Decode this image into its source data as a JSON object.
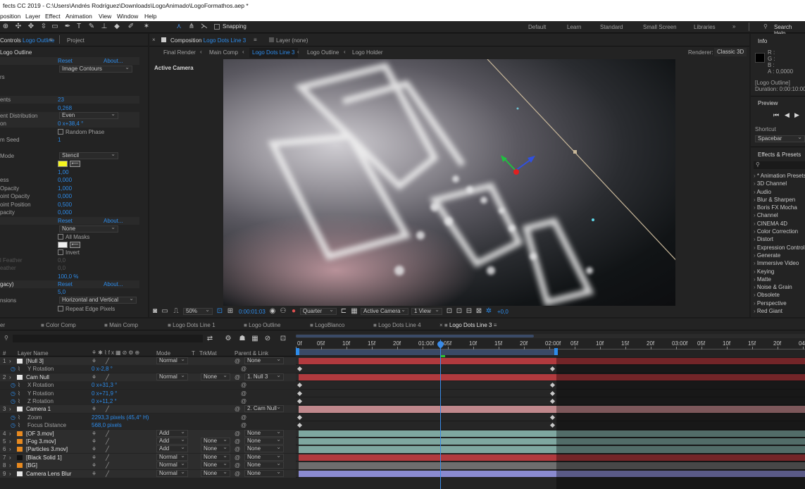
{
  "title": "fects CC 2019 - C:\\Users\\Andrés Rodríguez\\Downloads\\LogoAnimado\\LogoFormathos.aep *",
  "menu": [
    "position",
    "Layer",
    "Effect",
    "Animation",
    "View",
    "Window",
    "Help"
  ],
  "toolbar": {
    "snapping": "Snapping",
    "workspaces": [
      "Default",
      "Learn",
      "Standard",
      "Small Screen",
      "Libraries"
    ],
    "search": "Search Help"
  },
  "effects": {
    "tab1_prefix": "Controls",
    "tab1_name": "Logo Outline",
    "tab2": "Project",
    "layer": "Logo Outline",
    "reset": "Reset",
    "about": "About...",
    "image_contours": "Image Contours",
    "rs": "rs",
    "segments_label": "ents",
    "segments": "23",
    "length": "0,268",
    "seg_dist_label": "ent Distribution",
    "seg_dist": "Even",
    "rotation_label": "on",
    "rotation": "0 x+38,4 °",
    "random_phase": "Random Phase",
    "seed_label": "m Seed",
    "seed": "1",
    "mode_label": "Mode",
    "mode": "Stencil",
    "val100": "1,00",
    "thickness_label": "ess",
    "thickness": "0,000",
    "opacity_label": "Opacity",
    "opacity": "1,000",
    "mid_opacity_label": "oint Opacity",
    "mid_opacity": "0,000",
    "mid_pos_label": "oint Position",
    "mid_pos": "0,500",
    "opacity2_label": "pacity",
    "opacity2": "0,000",
    "reset2": "Reset",
    "about2": "About...",
    "none": "None",
    "all_masks": "All Masks",
    "invert": "Invert",
    "feather_label": "l Feather",
    "feather": "0,0",
    "feather2_label": "eather",
    "feather2": "0,0",
    "pct": "100,0 %",
    "legacy_label": "gacy)",
    "reset3": "Reset",
    "about3": "About...",
    "five": "5,0",
    "dims_label": "nsions",
    "dims": "Horizontal and Vertical",
    "repeat": "Repeat Edge Pixels"
  },
  "comp": {
    "comp_label": "Composition",
    "comp_name": "Logo Dots Line 3",
    "layer_none": "Layer  (none)",
    "breadcrumbs": [
      "Final Render",
      "Main Comp",
      "Logo Dots Line 3",
      "Logo Outline",
      "Logo Holder"
    ],
    "renderer_label": "Renderer:",
    "renderer": "Classic 3D",
    "active_camera": "Active Camera",
    "zoom": "50%",
    "timecode": "0:00:01:03",
    "resolution": "Quarter",
    "camera_view": "Active Camera",
    "views": "1 View",
    "exposure": "+0,0"
  },
  "info": {
    "title": "Info",
    "r": "R :",
    "g": "G :",
    "b": "B :",
    "a": "A : 0,0000",
    "layer": "[Logo Outline]",
    "duration": "Duration: 0:00:10:00"
  },
  "preview": {
    "title": "Preview",
    "shortcut": "Shortcut",
    "spacebar": "Spacebar"
  },
  "fx": {
    "title": "Effects & Presets",
    "items": [
      "* Animation Presets",
      "3D Channel",
      "Audio",
      "Blur & Sharpen",
      "Boris FX Mocha",
      "Channel",
      "CINEMA 4D",
      "Color Correction",
      "Distort",
      "Expression Controls",
      "Generate",
      "Immersive Video",
      "Keying",
      "Matte",
      "Noise & Grain",
      "Obsolete",
      "Perspective",
      "Red Giant"
    ]
  },
  "timeline": {
    "tabs": [
      "er",
      "Color Comp",
      "Main Comp",
      "Logo Dots Line 1",
      "Logo Outline",
      "LogoBlanco",
      "Logo Dots Line 4",
      "Logo Dots Line 3"
    ],
    "headers": {
      "hash": "#",
      "name": "Layer Name",
      "mode": "Mode",
      "t": "T",
      "trkmat": "TrkMat",
      "parent": "Parent & Link"
    },
    "ruler": [
      "0f",
      "05f",
      "10f",
      "15f",
      "20f",
      "01:00f",
      "05f",
      "10f",
      "15f",
      "20f",
      "02:00f",
      "05f",
      "10f",
      "15f",
      "20f",
      "03:00f",
      "05f",
      "10f",
      "15f",
      "20f",
      "04:0"
    ],
    "rows": [
      {
        "num": "1",
        "name": "[Null 3]",
        "mode": "Normal",
        "trk": "",
        "parent": "None",
        "sub": false
      },
      {
        "num": "",
        "name": "Y Rotation",
        "value": "0 x-2,8 °",
        "sub": true
      },
      {
        "num": "2",
        "name": "Cam Null",
        "mode": "Normal",
        "trk": "None",
        "parent": "1. Null 3",
        "sub": false
      },
      {
        "num": "",
        "name": "X Rotation",
        "value": "0 x+31,3 °",
        "sub": true
      },
      {
        "num": "",
        "name": "Y Rotation",
        "value": "0 x+71,9 °",
        "sub": true
      },
      {
        "num": "",
        "name": "Z Rotation",
        "value": "0 x+11,2 °",
        "sub": true
      },
      {
        "num": "3",
        "name": "Camera 1",
        "mode": "",
        "trk": "",
        "parent": "2. Cam Null",
        "sub": false
      },
      {
        "num": "",
        "name": "Zoom",
        "value": "2293,3  pixels (45,4° H)",
        "sub": true
      },
      {
        "num": "",
        "name": "Focus Distance",
        "value": "568,0  pixels",
        "sub": true
      },
      {
        "num": "4",
        "name": "[OF 3.mov]",
        "mode": "Add",
        "trk": "",
        "parent": "None",
        "sub": false
      },
      {
        "num": "5",
        "name": "[Fog 3.mov]",
        "mode": "Add",
        "trk": "None",
        "parent": "None",
        "sub": false
      },
      {
        "num": "6",
        "name": "[Particles 3.mov]",
        "mode": "Add",
        "trk": "None",
        "parent": "None",
        "sub": false
      },
      {
        "num": "7",
        "name": "[Black Solid 1]",
        "mode": "Normal",
        "trk": "None",
        "parent": "None",
        "sub": false
      },
      {
        "num": "8",
        "name": "[BG]",
        "mode": "Normal",
        "trk": "None",
        "parent": "None",
        "sub": false
      },
      {
        "num": "9",
        "name": "Camera Lens Blur",
        "mode": "Normal",
        "trk": "None",
        "parent": "None",
        "sub": false
      }
    ]
  },
  "colors": {
    "accent": "#2d8ceb",
    "red": "#b13a3e",
    "pink": "#c0888c",
    "teal": "#7fa7a0",
    "playhead": "#3a8be8"
  }
}
